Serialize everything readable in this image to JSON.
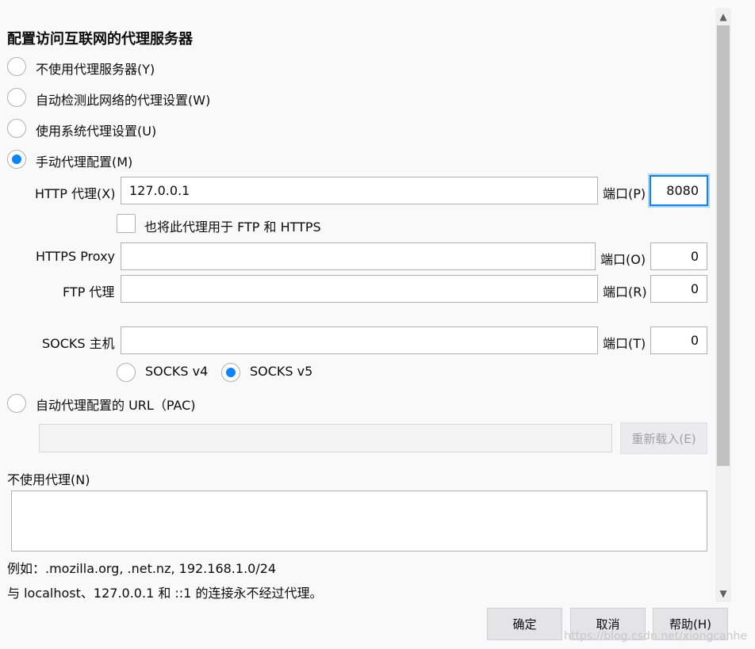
{
  "title": "配置访问互联网的代理服务器",
  "options": {
    "no_proxy": "不使用代理服务器(Y)",
    "auto_detect": "自动检测此网络的代理设置(W)",
    "system": "使用系统代理设置(U)",
    "manual": "手动代理配置(M)",
    "pac": "自动代理配置的 URL（PAC)"
  },
  "http": {
    "label": "HTTP 代理(X)",
    "value": "127.0.0.1",
    "port_label": "端口(P)",
    "port": "8080"
  },
  "share_checkbox": "也将此代理用于 FTP 和 HTTPS",
  "https": {
    "label": "HTTPS Proxy",
    "value": "",
    "port_label": "端口(O)",
    "port": "0"
  },
  "ftp": {
    "label": "FTP 代理",
    "value": "",
    "port_label": "端口(R)",
    "port": "0"
  },
  "socks": {
    "label": "SOCKS 主机",
    "value": "",
    "port_label": "端口(T)",
    "port": "0",
    "v4": "SOCKS v4",
    "v5": "SOCKS v5"
  },
  "pac_url": "",
  "reload_button": "重新载入(E)",
  "no_proxy_for": {
    "label": "不使用代理(N)",
    "value": ""
  },
  "example": "例如：.mozilla.org, .net.nz, 192.168.1.0/24",
  "localhost_note": "与 localhost、127.0.0.1 和 ::1 的连接永不经过代理。",
  "buttons": {
    "ok": "确定",
    "cancel": "取消",
    "help": "帮助(H)"
  },
  "watermark": "https://blog.csdn.net/xiongcanhe",
  "accent_color": "#0a84ff"
}
